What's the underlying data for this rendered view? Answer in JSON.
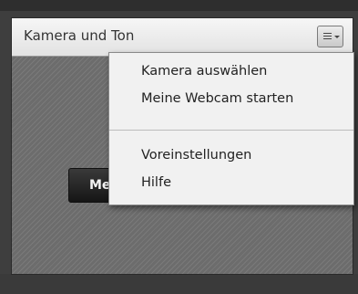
{
  "pod": {
    "title": "Kamera und Ton",
    "menu_button_icon": "hamburger-menu-icon"
  },
  "body": {
    "start_button_visible_text": "Me"
  },
  "menu": {
    "items": [
      {
        "label": "Kamera auswählen"
      },
      {
        "label": "Meine Webcam starten"
      },
      {
        "label": "Voreinstellungen"
      },
      {
        "label": "Hilfe"
      }
    ]
  },
  "colors": {
    "header_bg": "#e9e9e9",
    "menu_bg": "#f1f1f1",
    "button_bg": "#1e1e1e",
    "body_stripe": "#707070"
  }
}
